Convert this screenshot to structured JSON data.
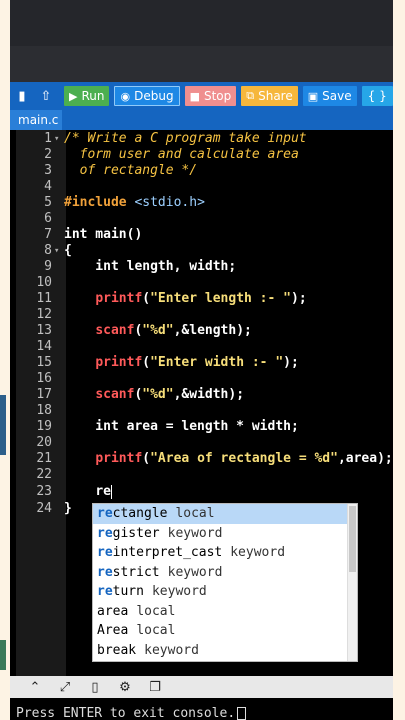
{
  "toolbar": {
    "run_label": "Run",
    "debug_label": "Debug",
    "stop_label": "Stop",
    "share_label": "Share",
    "save_label": "Save",
    "extra_label": "{ }"
  },
  "tab": {
    "label": "main.c"
  },
  "line_numbers": [
    "1",
    "2",
    "3",
    "4",
    "5",
    "6",
    "7",
    "8",
    "9",
    "10",
    "11",
    "12",
    "13",
    "14",
    "15",
    "16",
    "17",
    "18",
    "19",
    "20",
    "21",
    "22",
    "23",
    "24"
  ],
  "code": {
    "l1": "/* Write a C program take input",
    "l2": "  form user and calculate area",
    "l3": "  of rectangle */",
    "l5_pp": "#include ",
    "l5_hd": "<stdio.h>",
    "l7": "int main()",
    "l8": "{",
    "l9": "    int length, width;",
    "l11_fn": "printf",
    "l11_a": "(",
    "l11_s": "\"Enter length :- \"",
    "l11_b": ");",
    "l13_fn": "scanf",
    "l13_a": "(",
    "l13_s": "\"%d\"",
    "l13_b": ",&length);",
    "l15_fn": "printf",
    "l15_a": "(",
    "l15_s": "\"Enter width :- \"",
    "l15_b": ");",
    "l17_fn": "scanf",
    "l17_a": "(",
    "l17_s": "\"%d\"",
    "l17_b": ",&width);",
    "l19": "    int area = length * width;",
    "l21_fn": "printf",
    "l21_a": "(",
    "l21_s": "\"Area of rectangle = %d\"",
    "l21_b": ",area);",
    "l23": "re",
    "l24": "}"
  },
  "autocomplete": [
    {
      "match": "re",
      "rest": "ctangle",
      "type": "local"
    },
    {
      "match": "re",
      "rest": "gister",
      "type": "keyword"
    },
    {
      "match": "re",
      "rest": "interpret_cast",
      "type": "keyword"
    },
    {
      "match": "re",
      "rest": "strict",
      "type": "keyword"
    },
    {
      "match": "re",
      "rest": "turn",
      "type": "keyword"
    },
    {
      "match": "",
      "rest": "area",
      "type": "local"
    },
    {
      "match": "",
      "rest": "Area",
      "type": "local"
    },
    {
      "match": "",
      "rest": "break",
      "type": "keyword"
    }
  ],
  "console": {
    "text": "Press ENTER to exit console."
  },
  "colors": {
    "toolbar": "#1565c0",
    "run": "#4caf50",
    "stop": "#ef8f8f",
    "share": "#f6b73c",
    "comment": "#f6c343",
    "function": "#ff5a5a",
    "string": "#f7de7a"
  }
}
